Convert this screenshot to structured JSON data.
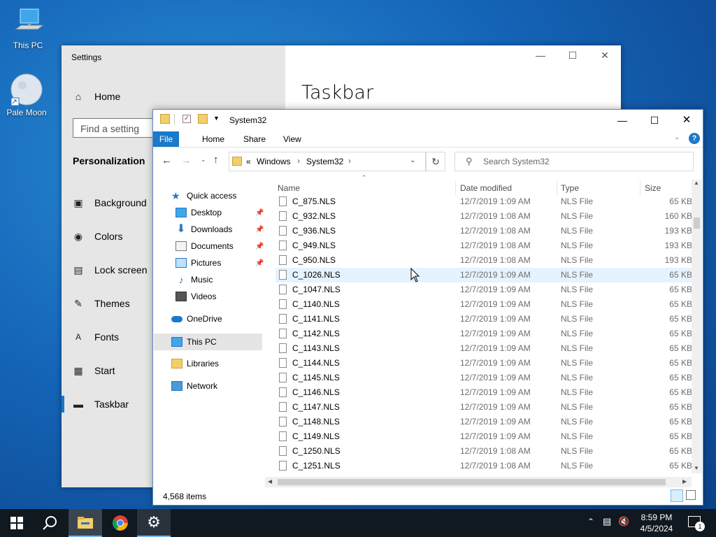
{
  "desktop": {
    "icons": [
      {
        "label": "This PC",
        "icon": "computer-icon"
      },
      {
        "label": "Pale Moon",
        "icon": "pale-moon-icon"
      }
    ]
  },
  "settings": {
    "title": "Settings",
    "home": "Home",
    "search_placeholder": "Find a setting",
    "section": "Personalization",
    "heading": "Taskbar",
    "items": [
      {
        "label": "Background",
        "icon": "image-icon"
      },
      {
        "label": "Colors",
        "icon": "palette-icon"
      },
      {
        "label": "Lock screen",
        "icon": "lock-screen-icon"
      },
      {
        "label": "Themes",
        "icon": "themes-icon"
      },
      {
        "label": "Fonts",
        "icon": "fonts-icon"
      },
      {
        "label": "Start",
        "icon": "start-icon"
      },
      {
        "label": "Taskbar",
        "icon": "taskbar-icon"
      }
    ]
  },
  "explorer": {
    "title": "System32",
    "ribbon": {
      "file": "File",
      "home": "Home",
      "share": "Share",
      "view": "View"
    },
    "address": {
      "prefix": "«",
      "crumb1": "Windows",
      "crumb2": "System32"
    },
    "search_placeholder": "Search System32",
    "nav": {
      "quick_access": "Quick access",
      "desktop": "Desktop",
      "downloads": "Downloads",
      "documents": "Documents",
      "pictures": "Pictures",
      "music": "Music",
      "videos": "Videos",
      "onedrive": "OneDrive",
      "this_pc": "This PC",
      "libraries": "Libraries",
      "network": "Network"
    },
    "columns": {
      "name": "Name",
      "date": "Date modified",
      "type": "Type",
      "size": "Size"
    },
    "rows": [
      {
        "name": "C_875.NLS",
        "date": "12/7/2019 1:09 AM",
        "type": "NLS File",
        "size": "65 KB"
      },
      {
        "name": "C_932.NLS",
        "date": "12/7/2019 1:08 AM",
        "type": "NLS File",
        "size": "160 KB"
      },
      {
        "name": "C_936.NLS",
        "date": "12/7/2019 1:08 AM",
        "type": "NLS File",
        "size": "193 KB"
      },
      {
        "name": "C_949.NLS",
        "date": "12/7/2019 1:08 AM",
        "type": "NLS File",
        "size": "193 KB"
      },
      {
        "name": "C_950.NLS",
        "date": "12/7/2019 1:08 AM",
        "type": "NLS File",
        "size": "193 KB"
      },
      {
        "name": "C_1026.NLS",
        "date": "12/7/2019 1:09 AM",
        "type": "NLS File",
        "size": "65 KB"
      },
      {
        "name": "C_1047.NLS",
        "date": "12/7/2019 1:09 AM",
        "type": "NLS File",
        "size": "65 KB"
      },
      {
        "name": "C_1140.NLS",
        "date": "12/7/2019 1:09 AM",
        "type": "NLS File",
        "size": "65 KB"
      },
      {
        "name": "C_1141.NLS",
        "date": "12/7/2019 1:09 AM",
        "type": "NLS File",
        "size": "65 KB"
      },
      {
        "name": "C_1142.NLS",
        "date": "12/7/2019 1:09 AM",
        "type": "NLS File",
        "size": "65 KB"
      },
      {
        "name": "C_1143.NLS",
        "date": "12/7/2019 1:09 AM",
        "type": "NLS File",
        "size": "65 KB"
      },
      {
        "name": "C_1144.NLS",
        "date": "12/7/2019 1:09 AM",
        "type": "NLS File",
        "size": "65 KB"
      },
      {
        "name": "C_1145.NLS",
        "date": "12/7/2019 1:09 AM",
        "type": "NLS File",
        "size": "65 KB"
      },
      {
        "name": "C_1146.NLS",
        "date": "12/7/2019 1:09 AM",
        "type": "NLS File",
        "size": "65 KB"
      },
      {
        "name": "C_1147.NLS",
        "date": "12/7/2019 1:09 AM",
        "type": "NLS File",
        "size": "65 KB"
      },
      {
        "name": "C_1148.NLS",
        "date": "12/7/2019 1:09 AM",
        "type": "NLS File",
        "size": "65 KB"
      },
      {
        "name": "C_1149.NLS",
        "date": "12/7/2019 1:09 AM",
        "type": "NLS File",
        "size": "65 KB"
      },
      {
        "name": "C_1250.NLS",
        "date": "12/7/2019 1:08 AM",
        "type": "NLS File",
        "size": "65 KB"
      },
      {
        "name": "C_1251.NLS",
        "date": "12/7/2019 1:08 AM",
        "type": "NLS File",
        "size": "65 KB"
      }
    ],
    "status": "4,568 items"
  },
  "taskbar": {
    "time": "8:59 PM",
    "date": "4/5/2024",
    "notifications": "1"
  },
  "colors": {
    "accent": "#1979ca",
    "taskbar": "#101820"
  }
}
